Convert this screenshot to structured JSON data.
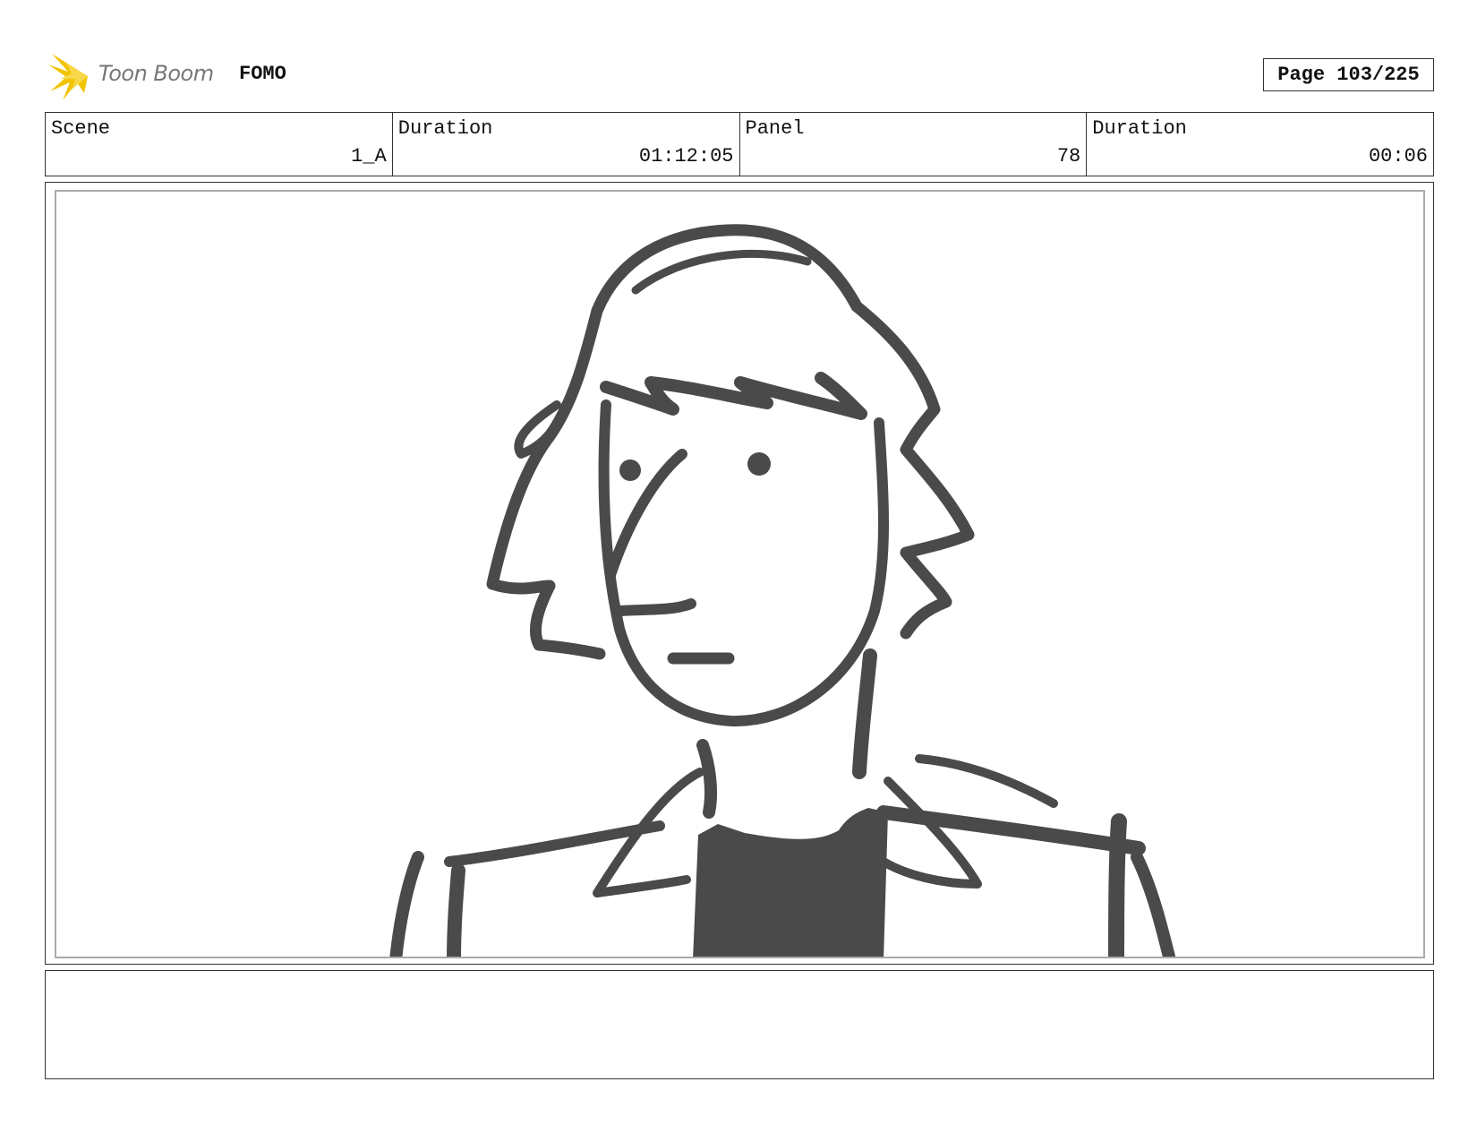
{
  "header": {
    "logo_text": "Toon Boom",
    "project_title": "FOMO",
    "page_label": "Page 103/225"
  },
  "info": [
    {
      "label": "Scene",
      "value": "1_A"
    },
    {
      "label": "Duration",
      "value": "01:12:05"
    },
    {
      "label": "Panel",
      "value": "78"
    },
    {
      "label": "Duration",
      "value": "00:06"
    }
  ],
  "panel": {
    "drawing": "character-sketch",
    "stroke_color": "#4a4a4a"
  },
  "notes": {
    "text": ""
  }
}
